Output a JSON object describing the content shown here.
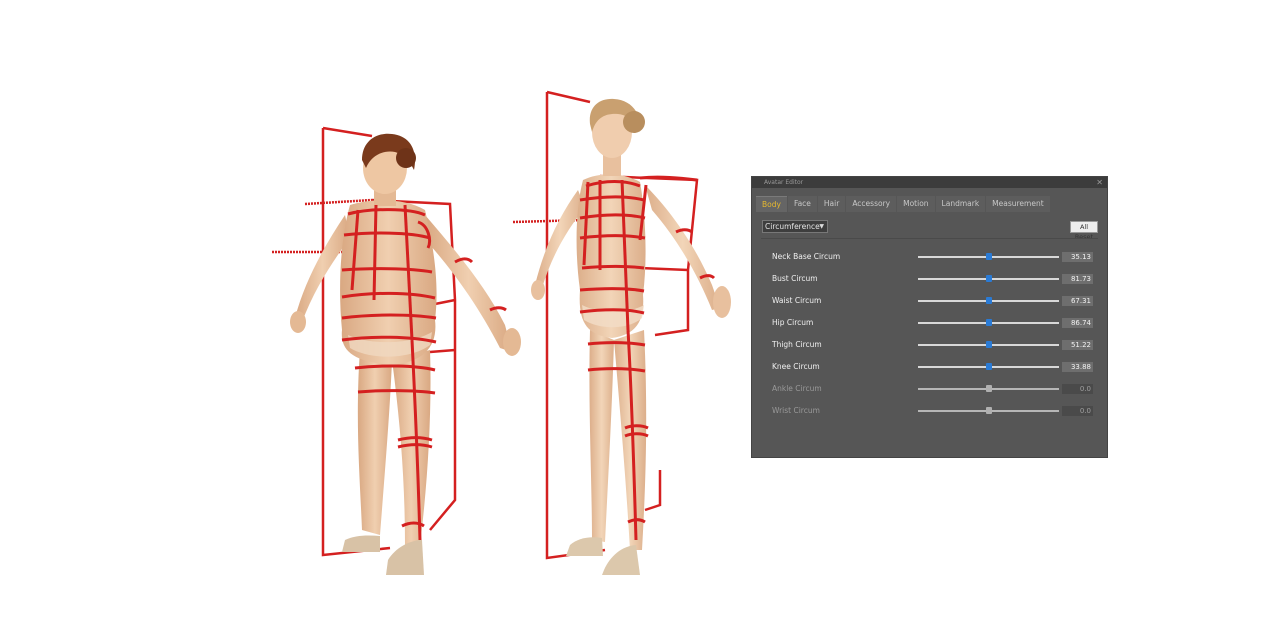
{
  "editor": {
    "title": "Avatar Editor",
    "close_icon": "close-icon",
    "tabs": [
      {
        "label": "Body",
        "active": true
      },
      {
        "label": "Face",
        "active": false
      },
      {
        "label": "Hair",
        "active": false
      },
      {
        "label": "Accessory",
        "active": false
      },
      {
        "label": "Motion",
        "active": false
      },
      {
        "label": "Landmark",
        "active": false
      },
      {
        "label": "Measurement",
        "active": false
      }
    ],
    "dropdown_value": "Circumference",
    "reset_label": "All Reset",
    "sliders": [
      {
        "label": "Neck Base Circum",
        "value": "35.13",
        "level": 0.5,
        "enabled": true
      },
      {
        "label": "Bust Circum",
        "value": "81.73",
        "level": 0.5,
        "enabled": true
      },
      {
        "label": "Waist Circum",
        "value": "67.31",
        "level": 0.5,
        "enabled": true
      },
      {
        "label": "Hip Circum",
        "value": "86.74",
        "level": 0.5,
        "enabled": true
      },
      {
        "label": "Thigh Circum",
        "value": "51.22",
        "level": 0.5,
        "enabled": true
      },
      {
        "label": "Knee Circum",
        "value": "33.88",
        "level": 0.5,
        "enabled": true
      },
      {
        "label": "Ankle Circum",
        "value": "0.0",
        "level": 0.5,
        "enabled": false
      },
      {
        "label": "Wrist Circum",
        "value": "0.0",
        "level": 0.5,
        "enabled": false
      }
    ]
  },
  "colors": {
    "panel_bg": "#565656",
    "active_tab_text": "#e7b92f",
    "slider_thumb": "#2a7bd6",
    "measure_line": "#d42020",
    "skin": "#e8c09a",
    "hair_dark": "#7a3a1c",
    "hair_light": "#c9a070"
  }
}
